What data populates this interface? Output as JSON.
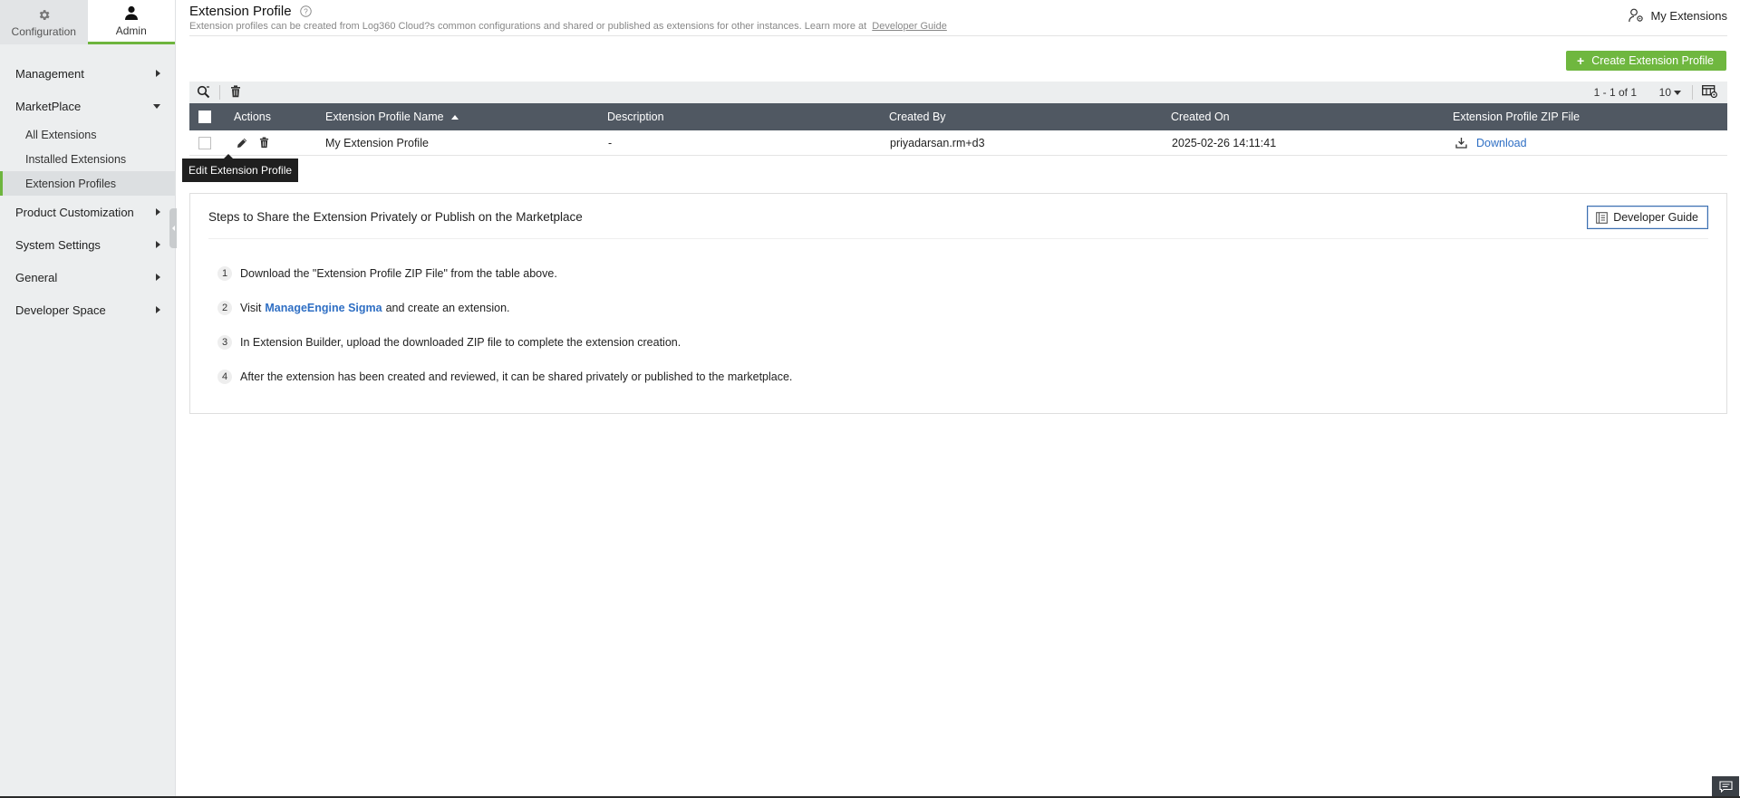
{
  "sidebar": {
    "tabs": [
      {
        "label": "Configuration",
        "icon": "gear-icon"
      },
      {
        "label": "Admin",
        "icon": "user-icon"
      }
    ],
    "nav": {
      "management": "Management",
      "marketplace": "MarketPlace",
      "marketplace_items": [
        "All Extensions",
        "Installed Extensions",
        "Extension Profiles"
      ],
      "product_customization": "Product Customization",
      "system_settings": "System Settings",
      "general": "General",
      "developer_space": "Developer Space"
    },
    "accent_color": "#6eb53e"
  },
  "header": {
    "title": "Extension Profile",
    "subtitle": "Extension profiles can be created from Log360 Cloud?s common configurations and shared or published as extensions for other instances. Learn more at",
    "subtitle_link": "Developer Guide",
    "my_extensions": "My Extensions"
  },
  "create_button": "Create Extension Profile",
  "toolbar": {
    "pager": "1 - 1 of 1",
    "page_size": "10"
  },
  "table": {
    "headers": {
      "actions": "Actions",
      "name": "Extension Profile Name",
      "description": "Description",
      "created_by": "Created By",
      "created_on": "Created On",
      "zip_file": "Extension Profile ZIP File"
    },
    "rows": [
      {
        "name": "My Extension Profile",
        "description": "-",
        "created_by": "priyadarsan.rm+d3",
        "created_on": "2025-02-26 14:11:41",
        "download": "Download"
      }
    ],
    "header_color": "#505862"
  },
  "tooltip": "Edit Extension Profile",
  "steps_panel": {
    "title": "Steps to Share the Extension Privately or Publish on the Marketplace",
    "developer_guide_button": "Developer Guide",
    "steps": [
      {
        "num": "1",
        "text": "Download the \"Extension Profile ZIP File\" from the table above."
      },
      {
        "num": "2",
        "pre": "Visit",
        "link": "ManageEngine Sigma",
        "post": "and create an extension."
      },
      {
        "num": "3",
        "text": "In Extension Builder, upload the downloaded ZIP file to complete the extension creation."
      },
      {
        "num": "4",
        "text": "After the extension has been created and reviewed, it can be shared privately or published to the marketplace."
      }
    ]
  }
}
